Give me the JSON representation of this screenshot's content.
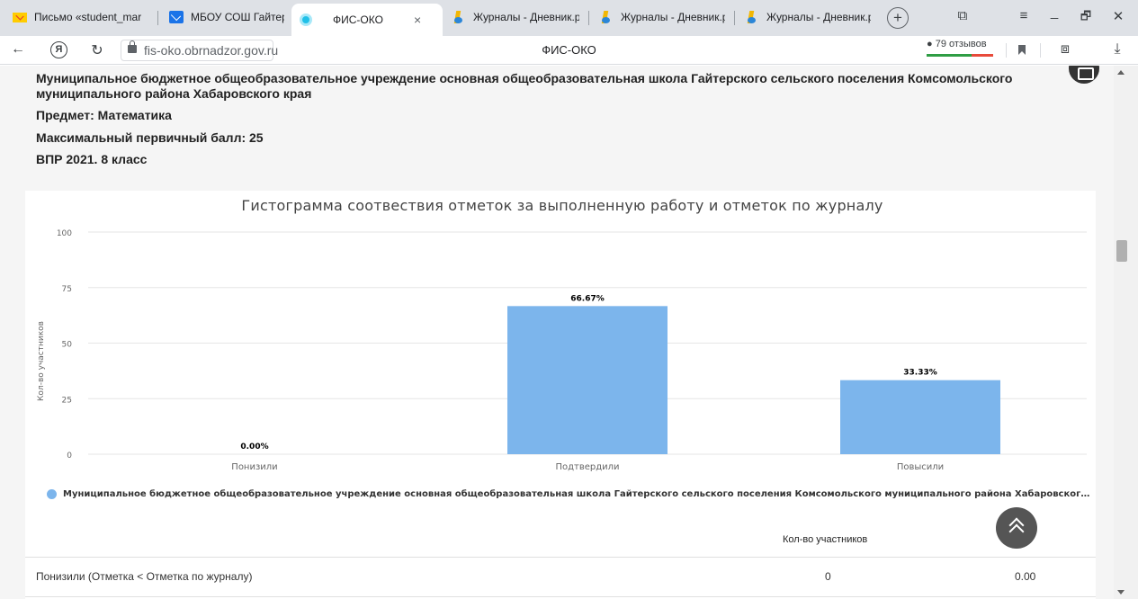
{
  "browser": {
    "tabs": [
      {
        "label": "Письмо «student_mar",
        "icon": "mail-icon"
      },
      {
        "label": "МБОУ СОШ Гайтерск",
        "icon": "envelope-icon"
      },
      {
        "label": "ФИС-ОКО",
        "icon": "fis-oko-icon",
        "active": true
      },
      {
        "label": "Журналы - Дневник.р",
        "icon": "dnevnik-icon"
      },
      {
        "label": "Журналы - Дневник.р",
        "icon": "dnevnik-icon"
      },
      {
        "label": "Журналы - Дневник.р",
        "icon": "dnevnik-icon"
      }
    ],
    "close_glyph": "×",
    "new_tab_glyph": "+",
    "url": "fis-oko.obrnadzor.gov.ru",
    "page_title": "ФИС-ОКО",
    "reviews": "79 отзывов",
    "window": {
      "tablist": "⧉",
      "menu": "≡",
      "minimize": "_",
      "restore": "🗗",
      "close": "✕"
    },
    "nav": {
      "back": "←",
      "reload": "↻",
      "ya": "Я",
      "download": "⤓",
      "reader": "⧈"
    }
  },
  "report": {
    "org_line1": "Муниципальное бюджетное общеобразовательное учреждение основная общеобразовательная школа Гайтерского сельского поселения Комсомольского",
    "org_line2": "муниципального района Хабаровского края",
    "subject": "Предмет: Математика",
    "max_score": "Максимальный первичный балл: 25",
    "exam": "ВПР 2021. 8 класс"
  },
  "chart_data": {
    "type": "bar",
    "title": "Гистограмма соотвествия отметок за выполненную работу и отметок по журналу",
    "ylabel": "Кол-во участников",
    "xlabel": "",
    "categories": [
      "Понизили",
      "Подтвердили",
      "Повысили"
    ],
    "series": [
      {
        "name": "Муниципальное бюджетное общеобразовательное учреждение основная общеобразовательная школа Гайтерского сельского поселения Комсомольского муниципального района Хабаровского кр...",
        "values": [
          0,
          66.67,
          33.33
        ],
        "labels": [
          "0.00%",
          "66.67%",
          "33.33%"
        ],
        "color": "#7cb5ec"
      }
    ],
    "yticks": [
      0,
      25,
      50,
      75,
      100
    ],
    "ylim": [
      0,
      100
    ],
    "grid": true,
    "legend": "bottom-left"
  },
  "table": {
    "col_header": "Кол-во участников",
    "rows": [
      {
        "label": "Понизили (Отметка < Отметка по журналу)",
        "count": "0",
        "percent": "0.00"
      }
    ]
  }
}
